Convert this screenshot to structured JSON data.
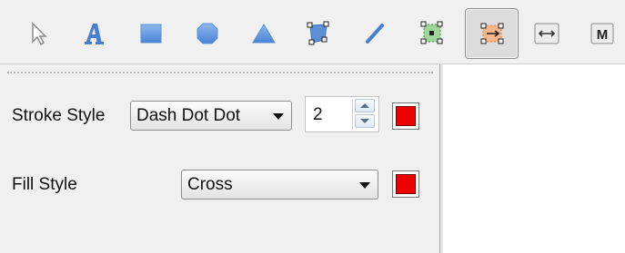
{
  "toolbar": {
    "tools": [
      {
        "name": "select-tool",
        "icon": "arrow-cursor-icon"
      },
      {
        "name": "text-tool",
        "icon": "text-a-icon"
      },
      {
        "name": "rectangle-tool",
        "icon": "rectangle-icon"
      },
      {
        "name": "ellipse-tool",
        "icon": "rounded-shape-icon"
      },
      {
        "name": "triangle-tool",
        "icon": "triangle-icon"
      },
      {
        "name": "polygon-tool",
        "icon": "polygon-handles-icon"
      },
      {
        "name": "line-tool",
        "icon": "line-icon"
      },
      {
        "name": "edit-points-tool",
        "icon": "node-edit-icon"
      },
      {
        "name": "transform-tool",
        "icon": "move-handles-icon",
        "active": true
      },
      {
        "name": "resize-tool",
        "icon": "horizontal-arrows-icon"
      },
      {
        "name": "m-tool",
        "icon": "m-letter-icon",
        "label": "M"
      }
    ]
  },
  "stroke": {
    "label": "Stroke Style",
    "style_value": "Dash Dot Dot",
    "width_value": "2",
    "color": "#ee0000"
  },
  "fill": {
    "label": "Fill Style",
    "style_value": "Cross",
    "color": "#ee0000"
  },
  "colors": {
    "toolbar_blue": "#5b8fd6",
    "active_orange": "#f0a060"
  }
}
